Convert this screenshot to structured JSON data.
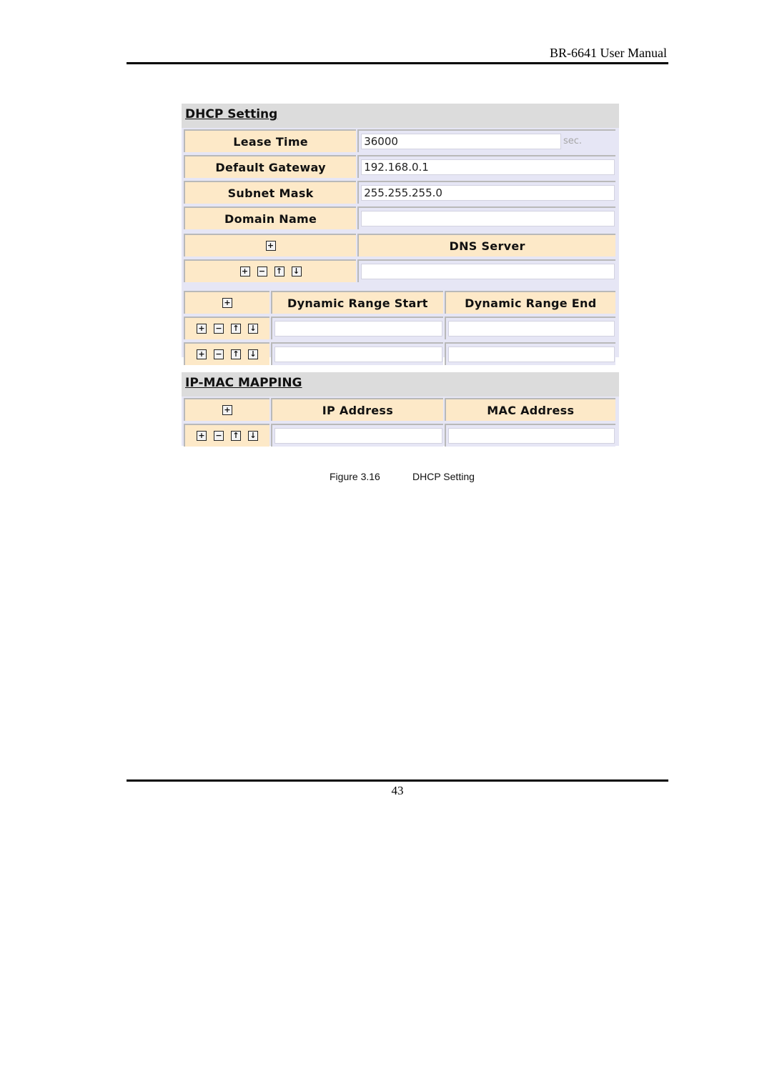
{
  "header": {
    "title": "BR-6641 User Manual"
  },
  "dhcp": {
    "title": "DHCP Setting",
    "rows": [
      {
        "label": "Lease Time",
        "value": "36000",
        "unit": "sec."
      },
      {
        "label": "Default Gateway",
        "value": "192.168.0.1"
      },
      {
        "label": "Subnet Mask",
        "value": "255.255.255.0"
      },
      {
        "label": "Domain Name",
        "value": ""
      }
    ],
    "dns": {
      "header": "DNS Server",
      "rows": [
        {
          "value": ""
        }
      ]
    },
    "range": {
      "start_header": "Dynamic Range Start",
      "end_header": "Dynamic Range End",
      "rows": [
        {
          "start": "",
          "end": ""
        },
        {
          "start": "",
          "end": ""
        }
      ]
    }
  },
  "ipmac": {
    "title": "IP-MAC MAPPING",
    "ip_header": "IP Address",
    "mac_header": "MAC Address",
    "rows": [
      {
        "ip": "",
        "mac": ""
      }
    ]
  },
  "icons": {
    "add": "+",
    "remove": "−",
    "up": "↑",
    "down": "↓"
  },
  "caption": {
    "number": "Figure 3.16",
    "text": "DHCP Setting"
  },
  "footer": {
    "page_number": "43"
  }
}
